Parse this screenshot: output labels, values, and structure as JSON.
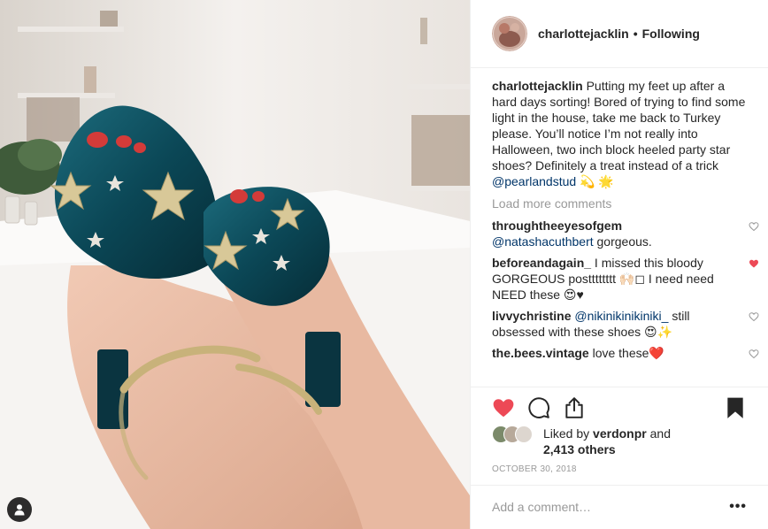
{
  "header": {
    "username": "charlottejacklin",
    "separator": "•",
    "follow_status": "Following"
  },
  "caption": {
    "username": "charlottejacklin",
    "text": "Putting my feet up after a hard days sorting! Bored of trying to find some light in the house, take me back to Turkey please. You’ll notice I’m not really into Halloween, two inch block heeled party star shoes? Definitely a treat instead of a trick",
    "mention": "@pearlandstud",
    "emoji": "💫 🌟"
  },
  "load_more_label": "Load more comments",
  "comments": [
    {
      "username": "throughtheeyesofgem",
      "mention": "@natashacuthbert",
      "text": "gorgeous.",
      "liked": false
    },
    {
      "username": "beforeandagain_",
      "mention": "",
      "text": "I missed this bloody GORGEOUS postttttttt 🙌🏻◻ I need need NEED these 😍♥",
      "liked": true
    },
    {
      "username": "livvychristine",
      "mention": "@nikinikinikiniki_",
      "text": "still obsessed with these shoes 😍✨",
      "liked": false
    },
    {
      "username": "the.bees.vintage",
      "mention": "",
      "text": "love these❤️",
      "liked": false
    }
  ],
  "actions": {
    "like_icon": "heart-filled-icon",
    "comment_icon": "speech-bubble-icon",
    "share_icon": "share-icon",
    "save_icon": "bookmark-filled-icon"
  },
  "likes": {
    "prefix": "Liked by",
    "user": "verdonpr",
    "and": "and",
    "others": "2,413 others"
  },
  "date": "OCTOBER 30, 2018",
  "add_comment": {
    "placeholder": "Add a comment…",
    "more_icon": "•••"
  },
  "colors": {
    "like_red": "#ed4956",
    "mention_blue": "#003569",
    "muted_gray": "#999999",
    "shoe_teal": "#0d4d5e",
    "star_gold": "#d8c898"
  }
}
